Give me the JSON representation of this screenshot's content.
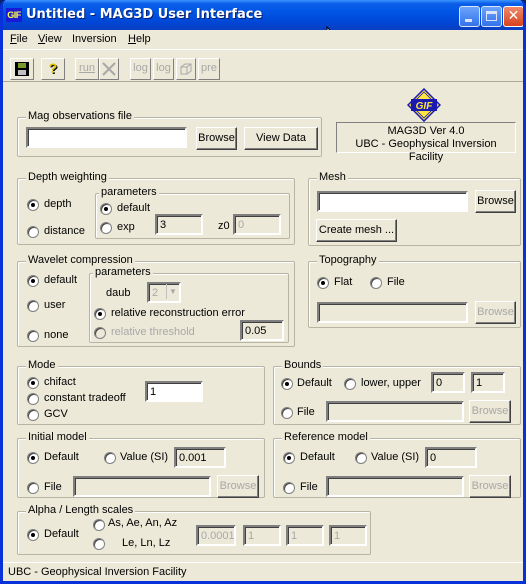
{
  "window": {
    "title": "Untitled - MAG3D User Interface",
    "app_icon_label": "GIF",
    "controls": {
      "minimize": "_",
      "maximize": "□",
      "close": "✕"
    }
  },
  "menu": [
    "File",
    "View",
    "Inversion",
    "Help"
  ],
  "menu_mnemonics": [
    "F",
    "V",
    "",
    "H"
  ],
  "toolbar": [
    {
      "name": "save",
      "label": "",
      "icon": "floppy-disk-icon",
      "enabled": true
    },
    {
      "name": "help",
      "label": "?",
      "icon": "question-mark-icon",
      "enabled": true
    },
    {
      "name": "run",
      "label": "run",
      "icon": "run-icon",
      "enabled": false
    },
    {
      "name": "stop",
      "label": "",
      "icon": "stop-cross-icon",
      "enabled": false
    },
    {
      "name": "log1",
      "label": "log",
      "icon": "log-icon",
      "enabled": false
    },
    {
      "name": "log2",
      "label": "log",
      "icon": "log-icon",
      "enabled": false
    },
    {
      "name": "model-view",
      "label": "",
      "icon": "3d-box-icon",
      "enabled": false
    },
    {
      "name": "pre",
      "label": "pre",
      "icon": "pre-icon",
      "enabled": false
    }
  ],
  "about": {
    "logo_text": "GIF",
    "line1": "MAG3D Ver 4.0",
    "line2": "UBC - Geophysical Inversion Facility"
  },
  "mag_obs": {
    "legend": "Mag observations file",
    "value": "",
    "browse_label": "Browse",
    "view_data_label": "View Data"
  },
  "depth_weighting": {
    "legend": "Depth weighting",
    "options": [
      {
        "label": "depth",
        "checked": true
      },
      {
        "label": "distance",
        "checked": false
      }
    ],
    "parameters": {
      "legend": "parameters",
      "options": [
        {
          "label": "default",
          "checked": true
        },
        {
          "label": "exp",
          "checked": false
        }
      ],
      "exp_value": "3",
      "z0_label": "z0",
      "z0_value": "0"
    }
  },
  "mesh": {
    "legend": "Mesh",
    "value": "",
    "browse_label": "Browse",
    "create_label": "Create mesh ..."
  },
  "wavelet": {
    "legend": "Wavelet compression",
    "options": [
      {
        "label": "default",
        "checked": true
      },
      {
        "label": "user",
        "checked": false
      },
      {
        "label": "none",
        "checked": false
      }
    ],
    "parameters": {
      "legend": "parameters",
      "daub_label": "daub",
      "daub_value": "2",
      "options": [
        {
          "label": "relative reconstruction error",
          "checked": true,
          "enabled": true
        },
        {
          "label": "relative threshold",
          "checked": false,
          "enabled": false
        }
      ],
      "value": "0.05"
    }
  },
  "topography": {
    "legend": "Topography",
    "options": [
      {
        "label": "Flat",
        "checked": true
      },
      {
        "label": "File",
        "checked": false
      }
    ],
    "value": "",
    "browse_label": "Browse"
  },
  "mode": {
    "legend": "Mode",
    "options": [
      {
        "label": "chifact",
        "checked": true
      },
      {
        "label": "constant tradeoff",
        "checked": false
      },
      {
        "label": "GCV",
        "checked": false
      }
    ],
    "value": "1"
  },
  "bounds": {
    "legend": "Bounds",
    "options": [
      {
        "label": "Default",
        "checked": true
      },
      {
        "label": "lower, upper",
        "checked": false
      },
      {
        "label": "File",
        "checked": false
      }
    ],
    "lower": "0",
    "upper": "1",
    "file_value": "",
    "browse_label": "Browse"
  },
  "initial_model": {
    "legend": "Initial model",
    "options": [
      {
        "label": "Default",
        "checked": true
      },
      {
        "label": "Value (SI)",
        "checked": false
      },
      {
        "label": "File",
        "checked": false
      }
    ],
    "value": "0.001",
    "file_value": "",
    "browse_label": "Browse"
  },
  "reference_model": {
    "legend": "Reference model",
    "options": [
      {
        "label": "Default",
        "checked": true
      },
      {
        "label": "Value (SI)",
        "checked": false
      },
      {
        "label": "File",
        "checked": false
      }
    ],
    "value": "0",
    "file_value": "",
    "browse_label": "Browse"
  },
  "alpha": {
    "legend": "Alpha / Length scales",
    "options": [
      {
        "label": "Default",
        "checked": true
      },
      {
        "label": "As, Ae, An, Az",
        "checked": false
      },
      {
        "label": "Le, Ln, Lz",
        "checked": false
      }
    ],
    "values": [
      "0.0001",
      "1",
      "1",
      "1"
    ]
  },
  "status_bar": {
    "text": "UBC - Geophysical Inversion Facility"
  }
}
